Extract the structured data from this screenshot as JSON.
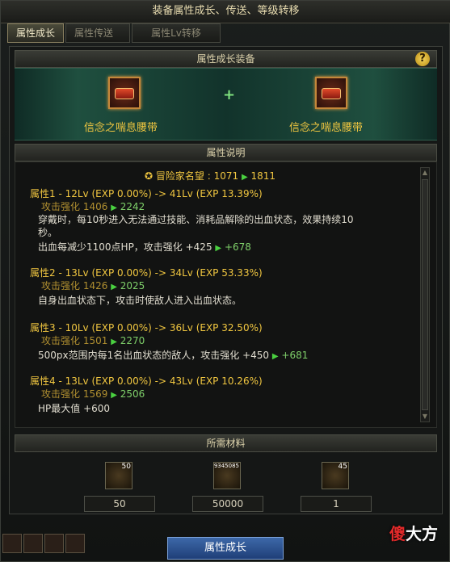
{
  "window": {
    "title": "装备属性成长、传送、等级转移"
  },
  "tabs": [
    {
      "label": "属性成长",
      "active": true
    },
    {
      "label": "属性传送",
      "active": false
    },
    {
      "label": "属性Lv转移",
      "active": false
    }
  ],
  "equip_section": {
    "header": "属性成长装备",
    "help": "?",
    "left_item": {
      "name": "信念之喘息腰带"
    },
    "plus": "+",
    "right_item": {
      "name": "信念之喘息腰带"
    }
  },
  "desc_section": {
    "header": "属性说明",
    "reputation": {
      "label": "冒险家名望 : 1071",
      "to": "1811"
    },
    "attributes": [
      {
        "title": "属性1 - 12Lv (EXP 0.00%) -> 41Lv (EXP 13.39%)",
        "stat": "攻击强化 1406",
        "stat_to": "2242",
        "desc": [
          "穿戴时，每10秒进入无法通过技能、消耗品解除的出血状态，效果持续10",
          "秒。"
        ],
        "extra": "出血每减少1100点HP，攻击强化 +425",
        "extra_to": "+678"
      },
      {
        "title": "属性2 - 13Lv (EXP 0.00%) -> 34Lv (EXP 53.33%)",
        "stat": "攻击强化 1426",
        "stat_to": "2025",
        "desc": [
          "自身出血状态下，攻击时使敌人进入出血状态。"
        ]
      },
      {
        "title": "属性3 - 10Lv (EXP 0.00%) -> 36Lv (EXP 32.50%)",
        "stat": "攻击强化 1501",
        "stat_to": "2270",
        "extra": "500px范围内每1名出血状态的敌人，攻击强化 +450",
        "extra_to": "+681"
      },
      {
        "title": "属性4 - 13Lv (EXP 0.00%) -> 43Lv (EXP 10.26%)",
        "stat": "攻击强化 1569",
        "stat_to": "2506",
        "extra": "HP最大值 +600"
      }
    ]
  },
  "materials": {
    "header": "所需材料",
    "items": [
      {
        "icon": "gold-bar-icon",
        "badge": "50",
        "count": "50"
      },
      {
        "icon": "gold-coins-icon",
        "badge": "9345085",
        "count": "50000"
      },
      {
        "icon": "burst-orb-icon",
        "badge": "45",
        "count": "1"
      }
    ]
  },
  "footer": {
    "button": "属性成长",
    "watermark_a": "傻",
    "watermark_b": "大方"
  }
}
